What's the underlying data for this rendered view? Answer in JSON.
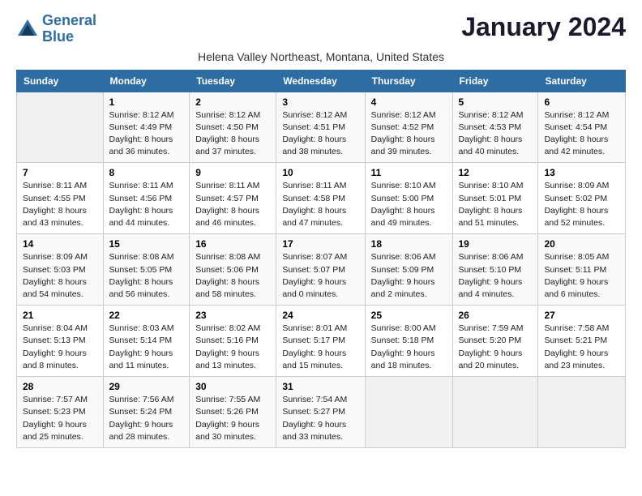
{
  "logo": {
    "line1": "General",
    "line2": "Blue"
  },
  "title": "January 2024",
  "subtitle": "Helena Valley Northeast, Montana, United States",
  "days_of_week": [
    "Sunday",
    "Monday",
    "Tuesday",
    "Wednesday",
    "Thursday",
    "Friday",
    "Saturday"
  ],
  "weeks": [
    [
      {
        "num": "",
        "detail": ""
      },
      {
        "num": "1",
        "detail": "Sunrise: 8:12 AM\nSunset: 4:49 PM\nDaylight: 8 hours\nand 36 minutes."
      },
      {
        "num": "2",
        "detail": "Sunrise: 8:12 AM\nSunset: 4:50 PM\nDaylight: 8 hours\nand 37 minutes."
      },
      {
        "num": "3",
        "detail": "Sunrise: 8:12 AM\nSunset: 4:51 PM\nDaylight: 8 hours\nand 38 minutes."
      },
      {
        "num": "4",
        "detail": "Sunrise: 8:12 AM\nSunset: 4:52 PM\nDaylight: 8 hours\nand 39 minutes."
      },
      {
        "num": "5",
        "detail": "Sunrise: 8:12 AM\nSunset: 4:53 PM\nDaylight: 8 hours\nand 40 minutes."
      },
      {
        "num": "6",
        "detail": "Sunrise: 8:12 AM\nSunset: 4:54 PM\nDaylight: 8 hours\nand 42 minutes."
      }
    ],
    [
      {
        "num": "7",
        "detail": "Sunrise: 8:11 AM\nSunset: 4:55 PM\nDaylight: 8 hours\nand 43 minutes."
      },
      {
        "num": "8",
        "detail": "Sunrise: 8:11 AM\nSunset: 4:56 PM\nDaylight: 8 hours\nand 44 minutes."
      },
      {
        "num": "9",
        "detail": "Sunrise: 8:11 AM\nSunset: 4:57 PM\nDaylight: 8 hours\nand 46 minutes."
      },
      {
        "num": "10",
        "detail": "Sunrise: 8:11 AM\nSunset: 4:58 PM\nDaylight: 8 hours\nand 47 minutes."
      },
      {
        "num": "11",
        "detail": "Sunrise: 8:10 AM\nSunset: 5:00 PM\nDaylight: 8 hours\nand 49 minutes."
      },
      {
        "num": "12",
        "detail": "Sunrise: 8:10 AM\nSunset: 5:01 PM\nDaylight: 8 hours\nand 51 minutes."
      },
      {
        "num": "13",
        "detail": "Sunrise: 8:09 AM\nSunset: 5:02 PM\nDaylight: 8 hours\nand 52 minutes."
      }
    ],
    [
      {
        "num": "14",
        "detail": "Sunrise: 8:09 AM\nSunset: 5:03 PM\nDaylight: 8 hours\nand 54 minutes."
      },
      {
        "num": "15",
        "detail": "Sunrise: 8:08 AM\nSunset: 5:05 PM\nDaylight: 8 hours\nand 56 minutes."
      },
      {
        "num": "16",
        "detail": "Sunrise: 8:08 AM\nSunset: 5:06 PM\nDaylight: 8 hours\nand 58 minutes."
      },
      {
        "num": "17",
        "detail": "Sunrise: 8:07 AM\nSunset: 5:07 PM\nDaylight: 9 hours\nand 0 minutes."
      },
      {
        "num": "18",
        "detail": "Sunrise: 8:06 AM\nSunset: 5:09 PM\nDaylight: 9 hours\nand 2 minutes."
      },
      {
        "num": "19",
        "detail": "Sunrise: 8:06 AM\nSunset: 5:10 PM\nDaylight: 9 hours\nand 4 minutes."
      },
      {
        "num": "20",
        "detail": "Sunrise: 8:05 AM\nSunset: 5:11 PM\nDaylight: 9 hours\nand 6 minutes."
      }
    ],
    [
      {
        "num": "21",
        "detail": "Sunrise: 8:04 AM\nSunset: 5:13 PM\nDaylight: 9 hours\nand 8 minutes."
      },
      {
        "num": "22",
        "detail": "Sunrise: 8:03 AM\nSunset: 5:14 PM\nDaylight: 9 hours\nand 11 minutes."
      },
      {
        "num": "23",
        "detail": "Sunrise: 8:02 AM\nSunset: 5:16 PM\nDaylight: 9 hours\nand 13 minutes."
      },
      {
        "num": "24",
        "detail": "Sunrise: 8:01 AM\nSunset: 5:17 PM\nDaylight: 9 hours\nand 15 minutes."
      },
      {
        "num": "25",
        "detail": "Sunrise: 8:00 AM\nSunset: 5:18 PM\nDaylight: 9 hours\nand 18 minutes."
      },
      {
        "num": "26",
        "detail": "Sunrise: 7:59 AM\nSunset: 5:20 PM\nDaylight: 9 hours\nand 20 minutes."
      },
      {
        "num": "27",
        "detail": "Sunrise: 7:58 AM\nSunset: 5:21 PM\nDaylight: 9 hours\nand 23 minutes."
      }
    ],
    [
      {
        "num": "28",
        "detail": "Sunrise: 7:57 AM\nSunset: 5:23 PM\nDaylight: 9 hours\nand 25 minutes."
      },
      {
        "num": "29",
        "detail": "Sunrise: 7:56 AM\nSunset: 5:24 PM\nDaylight: 9 hours\nand 28 minutes."
      },
      {
        "num": "30",
        "detail": "Sunrise: 7:55 AM\nSunset: 5:26 PM\nDaylight: 9 hours\nand 30 minutes."
      },
      {
        "num": "31",
        "detail": "Sunrise: 7:54 AM\nSunset: 5:27 PM\nDaylight: 9 hours\nand 33 minutes."
      },
      {
        "num": "",
        "detail": ""
      },
      {
        "num": "",
        "detail": ""
      },
      {
        "num": "",
        "detail": ""
      }
    ]
  ]
}
